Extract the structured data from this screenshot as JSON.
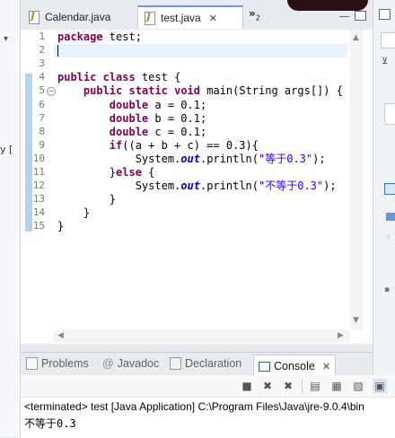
{
  "editor_tabs": [
    {
      "label": "Calendar.java",
      "active": false
    },
    {
      "label": "test.java",
      "active": true
    }
  ],
  "overflow_tabs": {
    "chevron": "»",
    "count": "2"
  },
  "code": {
    "line_numbers": [
      "1",
      "2",
      "3",
      "4",
      "5",
      "6",
      "7",
      "8",
      "9",
      "10",
      "11",
      "12",
      "13",
      "14",
      "15"
    ],
    "lines": [
      [
        {
          "t": "package",
          "c": "kw"
        },
        {
          "t": " test;"
        }
      ],
      [],
      [],
      [
        {
          "t": "public",
          "c": "kw"
        },
        {
          "t": " "
        },
        {
          "t": "class",
          "c": "kw"
        },
        {
          "t": " test {"
        }
      ],
      [
        {
          "t": "    "
        },
        {
          "t": "public",
          "c": "kw"
        },
        {
          "t": " "
        },
        {
          "t": "static",
          "c": "kw"
        },
        {
          "t": " "
        },
        {
          "t": "void",
          "c": "kw"
        },
        {
          "t": " main(String args[]) {"
        }
      ],
      [
        {
          "t": "        "
        },
        {
          "t": "double",
          "c": "kw"
        },
        {
          "t": " a = 0.1;"
        }
      ],
      [
        {
          "t": "        "
        },
        {
          "t": "double",
          "c": "kw"
        },
        {
          "t": " b = 0.1;"
        }
      ],
      [
        {
          "t": "        "
        },
        {
          "t": "double",
          "c": "kw"
        },
        {
          "t": " c = 0.1;"
        }
      ],
      [
        {
          "t": "        "
        },
        {
          "t": "if",
          "c": "kw"
        },
        {
          "t": "((a + b + c) == 0.3){"
        }
      ],
      [
        {
          "t": "            System."
        },
        {
          "t": "out",
          "c": "fld"
        },
        {
          "t": ".println("
        },
        {
          "t": "\"等于0.3\"",
          "c": "str"
        },
        {
          "t": ");"
        }
      ],
      [
        {
          "t": "        }"
        },
        {
          "t": "else",
          "c": "kw"
        },
        {
          "t": " {"
        }
      ],
      [
        {
          "t": "            System."
        },
        {
          "t": "out",
          "c": "fld"
        },
        {
          "t": ".println("
        },
        {
          "t": "\"不等于0.3\"",
          "c": "str"
        },
        {
          "t": ");"
        }
      ],
      [
        {
          "t": "        }"
        }
      ],
      [
        {
          "t": "    }"
        }
      ],
      [
        {
          "t": "}"
        }
      ]
    ]
  },
  "bottom_tabs": [
    {
      "label": "Problems",
      "icon": "problems-icon",
      "active": false
    },
    {
      "label": "Javadoc",
      "icon": "at-icon",
      "active": false
    },
    {
      "label": "Declaration",
      "icon": "declaration-icon",
      "active": false
    },
    {
      "label": "Console",
      "icon": "console-icon",
      "active": true
    }
  ],
  "console": {
    "status": "<terminated> test [Java Application] C:\\Program Files\\Java\\jre-9.0.4\\bin",
    "output": "不等于0.3"
  },
  "colors": {
    "keyword": "#7f0055",
    "string": "#2a00ff",
    "field": "#0000c0",
    "active_tab_accent": "#6b9bd1"
  }
}
